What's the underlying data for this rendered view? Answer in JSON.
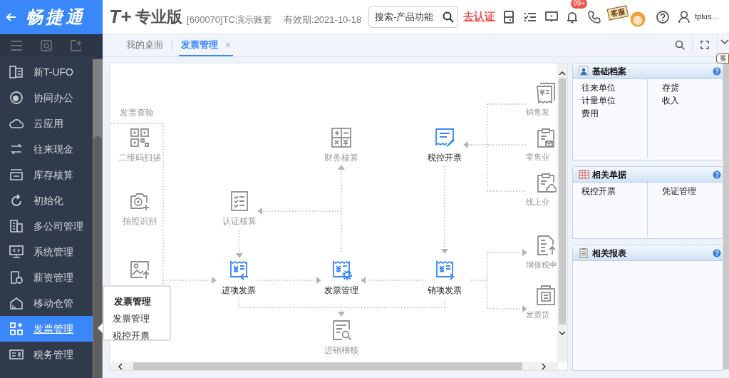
{
  "header": {
    "brand": "畅捷通",
    "product_mark": "T+",
    "edition": "专业版",
    "account": "[600070]TC演示账套",
    "validity": "有效期:2021-10-18",
    "search": {
      "placeholder": "搜索-产品功能"
    },
    "certify_link": "去认证",
    "notification_badge": "99+",
    "service_sign": "客服",
    "user": "tplus…"
  },
  "tabs": [
    {
      "label": "我的桌面",
      "selected": false
    },
    {
      "label": "发票管理",
      "selected": true,
      "close": "×"
    }
  ],
  "tooltip": "客",
  "sidebar": {
    "items": [
      {
        "label": "新T-UFO",
        "selected": false
      },
      {
        "label": "协同办公",
        "selected": false
      },
      {
        "label": "云应用",
        "selected": false
      },
      {
        "label": "往来现金",
        "selected": false
      },
      {
        "label": "库存核算",
        "selected": false
      },
      {
        "label": "初始化",
        "selected": false
      },
      {
        "label": "多公司管理",
        "selected": false
      },
      {
        "label": "系统管理",
        "selected": false
      },
      {
        "label": "薪资管理",
        "selected": false
      },
      {
        "label": "移动仓管",
        "selected": false
      },
      {
        "label": "发票管理",
        "selected": true
      },
      {
        "label": "税务管理",
        "selected": false
      }
    ]
  },
  "flyout": {
    "title": "发票管理",
    "items": [
      "发票管理",
      "税控开票"
    ]
  },
  "diagram": {
    "group_title": "发票查验",
    "nodes": [
      {
        "label": "二维码扫描",
        "kind": "secondary"
      },
      {
        "label": "拍照识别",
        "kind": "secondary"
      },
      {
        "kind": "secondary"
      },
      {
        "label": "认证核算",
        "kind": "secondary"
      },
      {
        "label": "财务核算",
        "kind": "secondary"
      },
      {
        "label": "税控开票",
        "kind": "primary"
      },
      {
        "label": "进项发票",
        "kind": "primary"
      },
      {
        "label": "发票管理",
        "kind": "primary"
      },
      {
        "label": "销项发票",
        "kind": "primary"
      },
      {
        "label": "进销稽核",
        "kind": "secondary"
      },
      {
        "label": "销售发",
        "kind": "secondary"
      },
      {
        "label": "零售业",
        "kind": "secondary"
      },
      {
        "label": "线上业",
        "kind": "secondary"
      },
      {
        "label": "增值税申",
        "kind": "secondary"
      },
      {
        "label": "发票贷",
        "kind": "secondary"
      }
    ]
  },
  "panels": [
    {
      "title": "基础档案",
      "kind": "archive",
      "columns": [
        [
          "往来单位",
          "计量单位",
          "费用"
        ],
        [
          "存货",
          "收入"
        ]
      ]
    },
    {
      "title": "相关单据",
      "kind": "documents",
      "columns": [
        [
          "税控开票"
        ],
        [
          "凭证管理"
        ]
      ]
    },
    {
      "title": "相关报表",
      "kind": "reports"
    }
  ]
}
